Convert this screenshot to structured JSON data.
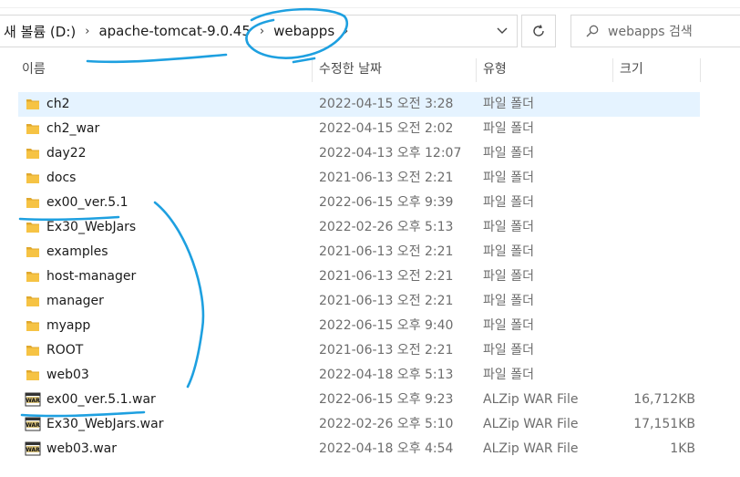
{
  "breadcrumbs": [
    "새 볼륨 (D:)",
    "apache-tomcat-9.0.45",
    "webapps"
  ],
  "search": {
    "placeholder": "webapps 검색"
  },
  "columns": {
    "name": "이름",
    "date": "수정한 날짜",
    "type": "유형",
    "size": "크기"
  },
  "accent": {
    "folder": "#f6c344",
    "selection": "#e5f3ff",
    "annotation": "#1ea0e0"
  },
  "rows": [
    {
      "name": "ch2",
      "date": "2022-04-15 오전 3:28",
      "type": "파일 폴더",
      "size": "",
      "icon": "folder-icon",
      "selected": true
    },
    {
      "name": "ch2_war",
      "date": "2022-04-15 오전 2:02",
      "type": "파일 폴더",
      "size": "",
      "icon": "folder-icon"
    },
    {
      "name": "day22",
      "date": "2022-04-13 오후 12:07",
      "type": "파일 폴더",
      "size": "",
      "icon": "folder-icon"
    },
    {
      "name": "docs",
      "date": "2021-06-13 오전 2:21",
      "type": "파일 폴더",
      "size": "",
      "icon": "folder-icon"
    },
    {
      "name": "ex00_ver.5.1",
      "date": "2022-06-15 오후 9:39",
      "type": "파일 폴더",
      "size": "",
      "icon": "folder-icon"
    },
    {
      "name": "Ex30_WebJars",
      "date": "2022-02-26 오후 5:13",
      "type": "파일 폴더",
      "size": "",
      "icon": "folder-icon"
    },
    {
      "name": "examples",
      "date": "2021-06-13 오전 2:21",
      "type": "파일 폴더",
      "size": "",
      "icon": "folder-icon"
    },
    {
      "name": "host-manager",
      "date": "2021-06-13 오전 2:21",
      "type": "파일 폴더",
      "size": "",
      "icon": "folder-icon"
    },
    {
      "name": "manager",
      "date": "2021-06-13 오전 2:21",
      "type": "파일 폴더",
      "size": "",
      "icon": "folder-icon"
    },
    {
      "name": "myapp",
      "date": "2022-06-15 오후 9:40",
      "type": "파일 폴더",
      "size": "",
      "icon": "folder-icon"
    },
    {
      "name": "ROOT",
      "date": "2021-06-13 오전 2:21",
      "type": "파일 폴더",
      "size": "",
      "icon": "folder-icon"
    },
    {
      "name": "web03",
      "date": "2022-04-18 오후 5:13",
      "type": "파일 폴더",
      "size": "",
      "icon": "folder-icon"
    },
    {
      "name": "ex00_ver.5.1.war",
      "date": "2022-06-15 오후 9:23",
      "type": "ALZip WAR File",
      "size": "16,712KB",
      "icon": "war-file-icon"
    },
    {
      "name": "Ex30_WebJars.war",
      "date": "2022-02-26 오후 5:10",
      "type": "ALZip WAR File",
      "size": "17,151KB",
      "icon": "war-file-icon"
    },
    {
      "name": "web03.war",
      "date": "2022-04-18 오후 4:54",
      "type": "ALZip WAR File",
      "size": "1KB",
      "icon": "war-file-icon"
    }
  ]
}
